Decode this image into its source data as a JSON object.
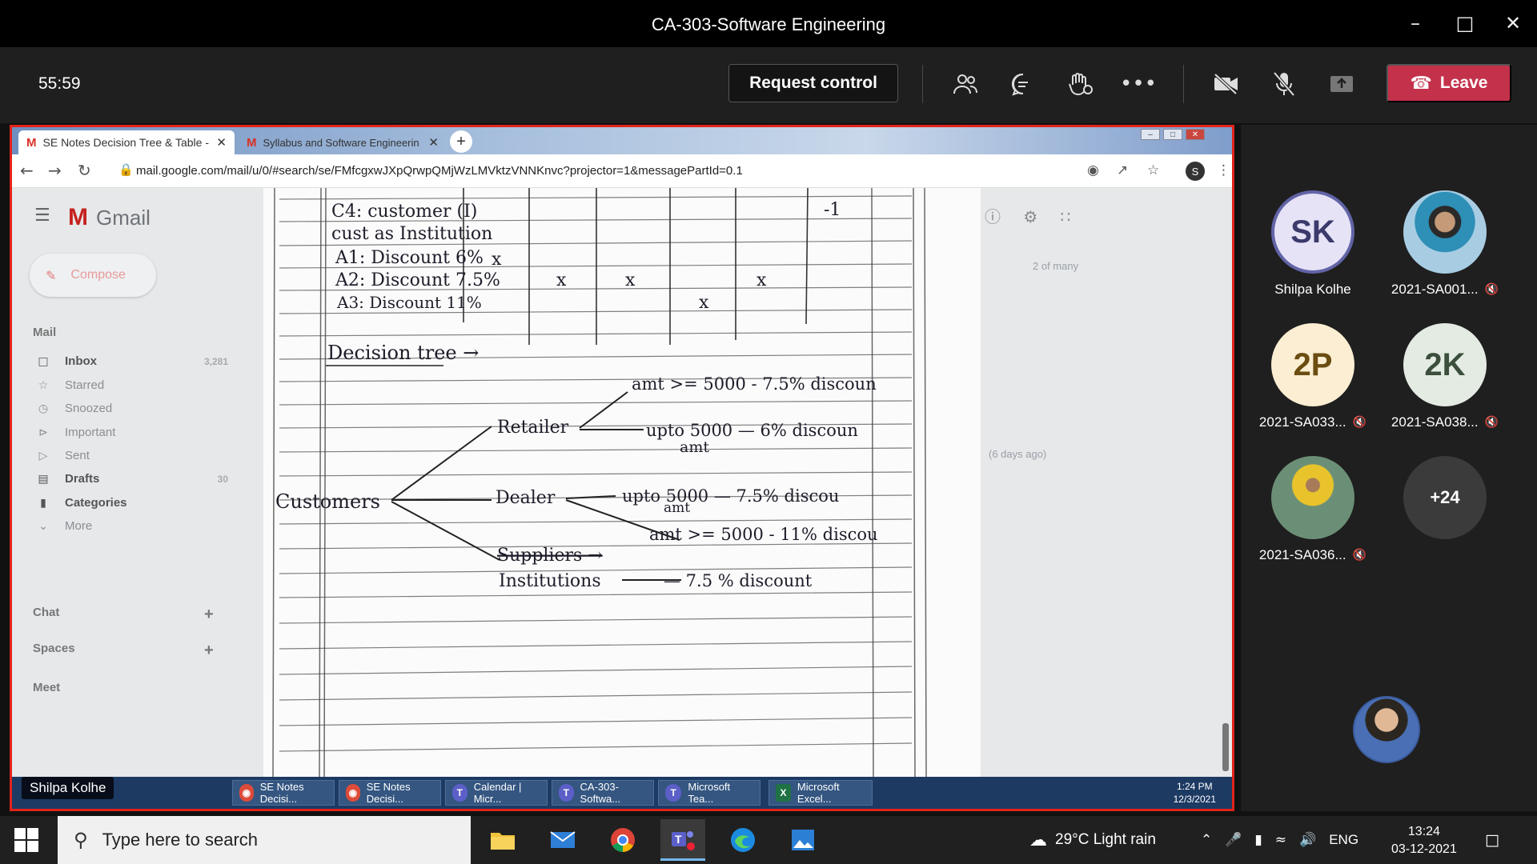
{
  "window": {
    "title": "CA-303-Software Engineering"
  },
  "meeting": {
    "timer": "55:59",
    "request_control": "Request control",
    "leave": "Leave"
  },
  "browser": {
    "tabs": [
      {
        "label": "SE Notes Decision Tree & Table -",
        "active": true
      },
      {
        "label": "Syllabus and Software Engineerin",
        "active": false
      }
    ],
    "url": "mail.google.com/mail/u/0/#search/se/FMfcgxwJXpQrwpQMjWzLMVktzVNNKnvc?projector=1&messagePartId=0.1",
    "profile_initial": "S"
  },
  "gmail": {
    "brand": "Gmail",
    "compose": "Compose",
    "mail_header": "Mail",
    "folders": [
      {
        "label": "Inbox",
        "count": "3,281",
        "icon": "inbox-icon"
      },
      {
        "label": "Starred",
        "count": "",
        "icon": "star-icon"
      },
      {
        "label": "Snoozed",
        "count": "",
        "icon": "clock-icon"
      },
      {
        "label": "Important",
        "count": "",
        "icon": "important-icon"
      },
      {
        "label": "Sent",
        "count": "",
        "icon": "send-icon"
      },
      {
        "label": "Drafts",
        "count": "30",
        "icon": "draft-icon"
      },
      {
        "label": "Categories",
        "count": "",
        "icon": "label-icon"
      },
      {
        "label": "More",
        "count": "",
        "icon": "chevron-down-icon"
      }
    ],
    "chat": "Chat",
    "spaces": "Spaces",
    "meet": "Meet",
    "pager": "2 of many",
    "msg_age": "(6 days ago)"
  },
  "note": {
    "table_rows": [
      "C4: customer (I)",
      "cust as Institution",
      "A1: Discount 6%",
      "A2: Discount 7.5%",
      "A3: Discount 11%"
    ],
    "heading": "Decision tree →",
    "root": "Customers",
    "branches": {
      "retailer": "Retailer",
      "dealer": "Dealer",
      "suppliers": "Suppliers →",
      "institutions": "Institutions"
    },
    "leaves": {
      "r1": "amt >= 5000 - 7.5% discoun",
      "r2": "upto 5000 — 6% discoun",
      "r2b": "amt",
      "d1": "upto 5000 — 7.5% discou",
      "d1b": "amt",
      "d2": "amt >= 5000 - 11% discou",
      "i1": "— 7.5 % discount"
    }
  },
  "shared_taskbar": {
    "sharer": "Shilpa Kolhe",
    "buttons": [
      {
        "label": "SE Notes Decisi...",
        "icon": "chrome-icon"
      },
      {
        "label": "SE Notes Decisi...",
        "icon": "chrome-icon"
      },
      {
        "label": "Calendar | Micr...",
        "icon": "teams-icon"
      },
      {
        "label": "CA-303-Softwa...",
        "icon": "teams-icon"
      },
      {
        "label": "Microsoft Tea...",
        "icon": "teams-icon"
      },
      {
        "label": "Microsoft Excel...",
        "icon": "excel-icon"
      }
    ],
    "time": "1:24 PM",
    "date": "12/3/2021"
  },
  "participants": [
    {
      "initials": "SK",
      "name": "Shilpa Kolhe",
      "muted": false,
      "photo": false,
      "bg": "#e7e3f7"
    },
    {
      "initials": "",
      "name": "2021-SA001...",
      "muted": true,
      "photo": true,
      "bg": "#6d8aa8"
    },
    {
      "initials": "2P",
      "name": "2021-SA033...",
      "muted": true,
      "photo": false,
      "bg": "#fbeed2"
    },
    {
      "initials": "2K",
      "name": "2021-SA038...",
      "muted": true,
      "photo": false,
      "bg": "#e3ebe3"
    },
    {
      "initials": "",
      "name": "2021-SA036...",
      "muted": true,
      "photo": true,
      "bg": "#5a7a62"
    },
    {
      "initials": "+24",
      "name": "",
      "muted": false,
      "photo": false,
      "bg": "#3b3b3b"
    }
  ],
  "taskbar": {
    "search_placeholder": "Type here to search",
    "weather": "29°C  Light rain",
    "lang": "ENG",
    "time": "13:24",
    "date": "03-12-2021"
  },
  "colors": {
    "leave": "#c4314b",
    "share_border": "#e2231a",
    "accent": "#6264a7"
  }
}
